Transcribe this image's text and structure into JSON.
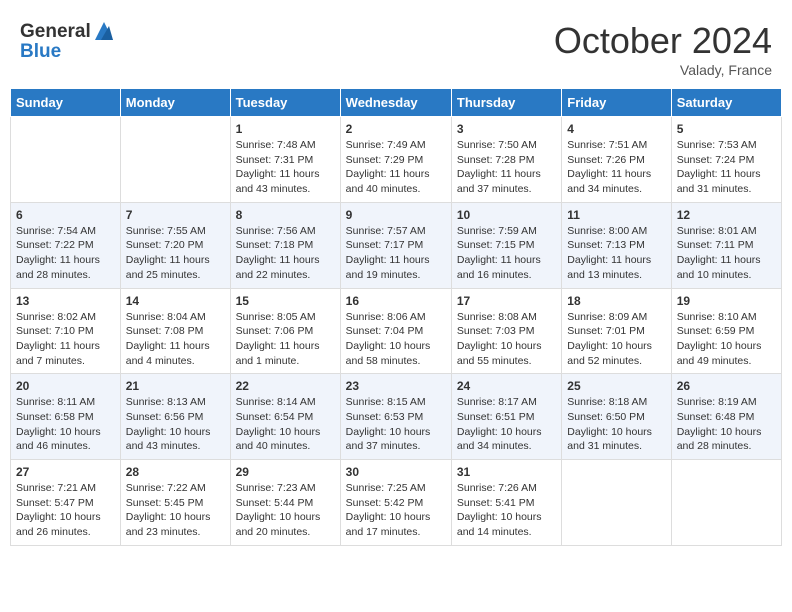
{
  "header": {
    "logo_line1": "General",
    "logo_line2": "Blue",
    "month": "October 2024",
    "location": "Valady, France"
  },
  "weekdays": [
    "Sunday",
    "Monday",
    "Tuesday",
    "Wednesday",
    "Thursday",
    "Friday",
    "Saturday"
  ],
  "weeks": [
    [
      {
        "day": "",
        "sunrise": "",
        "sunset": "",
        "daylight": ""
      },
      {
        "day": "",
        "sunrise": "",
        "sunset": "",
        "daylight": ""
      },
      {
        "day": "1",
        "sunrise": "Sunrise: 7:48 AM",
        "sunset": "Sunset: 7:31 PM",
        "daylight": "Daylight: 11 hours and 43 minutes."
      },
      {
        "day": "2",
        "sunrise": "Sunrise: 7:49 AM",
        "sunset": "Sunset: 7:29 PM",
        "daylight": "Daylight: 11 hours and 40 minutes."
      },
      {
        "day": "3",
        "sunrise": "Sunrise: 7:50 AM",
        "sunset": "Sunset: 7:28 PM",
        "daylight": "Daylight: 11 hours and 37 minutes."
      },
      {
        "day": "4",
        "sunrise": "Sunrise: 7:51 AM",
        "sunset": "Sunset: 7:26 PM",
        "daylight": "Daylight: 11 hours and 34 minutes."
      },
      {
        "day": "5",
        "sunrise": "Sunrise: 7:53 AM",
        "sunset": "Sunset: 7:24 PM",
        "daylight": "Daylight: 11 hours and 31 minutes."
      }
    ],
    [
      {
        "day": "6",
        "sunrise": "Sunrise: 7:54 AM",
        "sunset": "Sunset: 7:22 PM",
        "daylight": "Daylight: 11 hours and 28 minutes."
      },
      {
        "day": "7",
        "sunrise": "Sunrise: 7:55 AM",
        "sunset": "Sunset: 7:20 PM",
        "daylight": "Daylight: 11 hours and 25 minutes."
      },
      {
        "day": "8",
        "sunrise": "Sunrise: 7:56 AM",
        "sunset": "Sunset: 7:18 PM",
        "daylight": "Daylight: 11 hours and 22 minutes."
      },
      {
        "day": "9",
        "sunrise": "Sunrise: 7:57 AM",
        "sunset": "Sunset: 7:17 PM",
        "daylight": "Daylight: 11 hours and 19 minutes."
      },
      {
        "day": "10",
        "sunrise": "Sunrise: 7:59 AM",
        "sunset": "Sunset: 7:15 PM",
        "daylight": "Daylight: 11 hours and 16 minutes."
      },
      {
        "day": "11",
        "sunrise": "Sunrise: 8:00 AM",
        "sunset": "Sunset: 7:13 PM",
        "daylight": "Daylight: 11 hours and 13 minutes."
      },
      {
        "day": "12",
        "sunrise": "Sunrise: 8:01 AM",
        "sunset": "Sunset: 7:11 PM",
        "daylight": "Daylight: 11 hours and 10 minutes."
      }
    ],
    [
      {
        "day": "13",
        "sunrise": "Sunrise: 8:02 AM",
        "sunset": "Sunset: 7:10 PM",
        "daylight": "Daylight: 11 hours and 7 minutes."
      },
      {
        "day": "14",
        "sunrise": "Sunrise: 8:04 AM",
        "sunset": "Sunset: 7:08 PM",
        "daylight": "Daylight: 11 hours and 4 minutes."
      },
      {
        "day": "15",
        "sunrise": "Sunrise: 8:05 AM",
        "sunset": "Sunset: 7:06 PM",
        "daylight": "Daylight: 11 hours and 1 minute."
      },
      {
        "day": "16",
        "sunrise": "Sunrise: 8:06 AM",
        "sunset": "Sunset: 7:04 PM",
        "daylight": "Daylight: 10 hours and 58 minutes."
      },
      {
        "day": "17",
        "sunrise": "Sunrise: 8:08 AM",
        "sunset": "Sunset: 7:03 PM",
        "daylight": "Daylight: 10 hours and 55 minutes."
      },
      {
        "day": "18",
        "sunrise": "Sunrise: 8:09 AM",
        "sunset": "Sunset: 7:01 PM",
        "daylight": "Daylight: 10 hours and 52 minutes."
      },
      {
        "day": "19",
        "sunrise": "Sunrise: 8:10 AM",
        "sunset": "Sunset: 6:59 PM",
        "daylight": "Daylight: 10 hours and 49 minutes."
      }
    ],
    [
      {
        "day": "20",
        "sunrise": "Sunrise: 8:11 AM",
        "sunset": "Sunset: 6:58 PM",
        "daylight": "Daylight: 10 hours and 46 minutes."
      },
      {
        "day": "21",
        "sunrise": "Sunrise: 8:13 AM",
        "sunset": "Sunset: 6:56 PM",
        "daylight": "Daylight: 10 hours and 43 minutes."
      },
      {
        "day": "22",
        "sunrise": "Sunrise: 8:14 AM",
        "sunset": "Sunset: 6:54 PM",
        "daylight": "Daylight: 10 hours and 40 minutes."
      },
      {
        "day": "23",
        "sunrise": "Sunrise: 8:15 AM",
        "sunset": "Sunset: 6:53 PM",
        "daylight": "Daylight: 10 hours and 37 minutes."
      },
      {
        "day": "24",
        "sunrise": "Sunrise: 8:17 AM",
        "sunset": "Sunset: 6:51 PM",
        "daylight": "Daylight: 10 hours and 34 minutes."
      },
      {
        "day": "25",
        "sunrise": "Sunrise: 8:18 AM",
        "sunset": "Sunset: 6:50 PM",
        "daylight": "Daylight: 10 hours and 31 minutes."
      },
      {
        "day": "26",
        "sunrise": "Sunrise: 8:19 AM",
        "sunset": "Sunset: 6:48 PM",
        "daylight": "Daylight: 10 hours and 28 minutes."
      }
    ],
    [
      {
        "day": "27",
        "sunrise": "Sunrise: 7:21 AM",
        "sunset": "Sunset: 5:47 PM",
        "daylight": "Daylight: 10 hours and 26 minutes."
      },
      {
        "day": "28",
        "sunrise": "Sunrise: 7:22 AM",
        "sunset": "Sunset: 5:45 PM",
        "daylight": "Daylight: 10 hours and 23 minutes."
      },
      {
        "day": "29",
        "sunrise": "Sunrise: 7:23 AM",
        "sunset": "Sunset: 5:44 PM",
        "daylight": "Daylight: 10 hours and 20 minutes."
      },
      {
        "day": "30",
        "sunrise": "Sunrise: 7:25 AM",
        "sunset": "Sunset: 5:42 PM",
        "daylight": "Daylight: 10 hours and 17 minutes."
      },
      {
        "day": "31",
        "sunrise": "Sunrise: 7:26 AM",
        "sunset": "Sunset: 5:41 PM",
        "daylight": "Daylight: 10 hours and 14 minutes."
      },
      {
        "day": "",
        "sunrise": "",
        "sunset": "",
        "daylight": ""
      },
      {
        "day": "",
        "sunrise": "",
        "sunset": "",
        "daylight": ""
      }
    ]
  ]
}
